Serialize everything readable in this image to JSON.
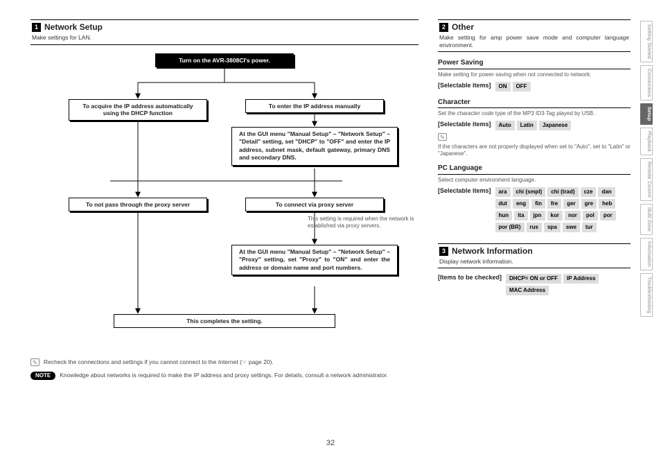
{
  "page_number": "32",
  "side_tabs": [
    "Getting Started",
    "Connections",
    "Setup",
    "Playback",
    "Remote Control",
    "Multi-Zone",
    "Information",
    "Troubleshooting"
  ],
  "side_active_index": 2,
  "section1": {
    "num": "1",
    "title": "Network Setup",
    "desc": "Make settings for LAN."
  },
  "section2": {
    "num": "2",
    "title": "Other",
    "desc": "Make setting for amp power save mode and computer language environment."
  },
  "section3": {
    "num": "3",
    "title": "Network Information",
    "desc": "Display network information."
  },
  "flow": {
    "start": "Turn on the AVR-3808CI's power.",
    "dhcp_auto": "To acquire the IP address automatically using the DHCP function",
    "dhcp_manual": "To enter the IP address manually",
    "manual_detail": "At the GUI menu \"Manual Setup\" – \"Network Setup\" – \"Detail\" setting, set \"DHCP\" to \"OFF\" and enter the IP address, subnet mask, default gateway, primary DNS and secondary DNS.",
    "proxy_no": "To not pass through the proxy server",
    "proxy_yes": "To connect via proxy server",
    "proxy_note": "This setting is required when the network is established via proxy servers.",
    "proxy_detail": "At the GUI menu \"Manual Setup\" – \"Network Setup\" – \"Proxy\" setting, set \"Proxy\" to \"ON\" and enter the address or domain name and port numbers.",
    "complete": "This completes the setting."
  },
  "tip_row": "Recheck the connections and settings if you cannot connect to the Internet (☞ page 20).",
  "note_label": "NOTE",
  "note_text": "Knowledge about networks is required to make the IP address and proxy settings. For details, consult a network administrator.",
  "power_saving": {
    "title": "Power Saving",
    "desc": "Make setting for power saving when not connected to network.",
    "label": "[Selectable items]",
    "items": [
      "ON",
      "OFF"
    ]
  },
  "character": {
    "title": "Character",
    "desc": "Set the character code type of the MP3 ID3-Tag played by USB.",
    "label": "[Selectable items]",
    "items": [
      "Auto",
      "Latin",
      "Japanese"
    ],
    "tip": "If the characters are not properly displayed when set to \"Auto\", set to \"Latin\" or \"Japanese\"."
  },
  "pc_lang": {
    "title": "PC Language",
    "desc": "Select computer environment language.",
    "label": "[Selectable items]",
    "items": [
      "ara",
      "chi (smpl)",
      "chi (trad)",
      "cze",
      "dan",
      "dut",
      "eng",
      "fin",
      "fre",
      "ger",
      "gre",
      "heb",
      "hun",
      "ita",
      "jpn",
      "kor",
      "nor",
      "pol",
      "por",
      "por (BR)",
      "rus",
      "spa",
      "swe",
      "tur"
    ]
  },
  "net_info": {
    "label": "[Items to be checked]",
    "items": [
      "DHCP= ON or OFF",
      "IP Address",
      "MAC Address"
    ]
  }
}
